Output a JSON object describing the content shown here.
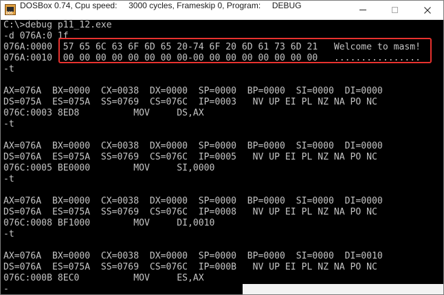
{
  "window": {
    "app_name": "DOSBox 0.74, Cpu speed:",
    "cpu_speed": "3000 cycles, Frameskip",
    "frameskip": "0, Program:",
    "program": "DEBUG",
    "icon": "dosbox-app-icon",
    "icon_text": "DOS BOX"
  },
  "controls": {
    "minimize": "minimize-icon",
    "maximize": "maximize-icon",
    "close": "close-icon"
  },
  "console": {
    "lines": [
      "C:\\>debug p11_12.exe",
      "-d 076A:0 1f",
      "076A:0000  57 65 6C 63 6F 6D 65 20-74 6F 20 6D 61 73 6D 21   Welcome to masm!",
      "076A:0010  00 00 00 00 00 00 00 00-00 00 00 00 00 00 00 00   ................",
      "-t",
      "",
      "AX=076A  BX=0000  CX=0038  DX=0000  SP=0000  BP=0000  SI=0000  DI=0000",
      "DS=075A  ES=075A  SS=0769  CS=076C  IP=0003   NV UP EI PL NZ NA PO NC",
      "076C:0003 8ED8          MOV     DS,AX",
      "-t",
      "",
      "AX=076A  BX=0000  CX=0038  DX=0000  SP=0000  BP=0000  SI=0000  DI=0000",
      "DS=076A  ES=075A  SS=0769  CS=076C  IP=0005   NV UP EI PL NZ NA PO NC",
      "076C:0005 BE0000        MOV     SI,0000",
      "-t",
      "",
      "AX=076A  BX=0000  CX=0038  DX=0000  SP=0000  BP=0000  SI=0000  DI=0000",
      "DS=076A  ES=075A  SS=0769  CS=076C  IP=0008   NV UP EI PL NZ NA PO NC",
      "076C:0008 BF1000        MOV     DI,0010",
      "-t",
      "",
      "AX=076A  BX=0000  CX=0038  DX=0000  SP=0000  BP=0000  SI=0000  DI=0010",
      "DS=076A  ES=075A  SS=0769  CS=076C  IP=000B   NV UP EI PL NZ NA PO NC",
      "076C:000B 8EC0          MOV     ES,AX",
      "-"
    ]
  },
  "colors": {
    "console_bg": "#000000",
    "console_text": "#c4c4c4",
    "highlight_border": "#e8322f",
    "titlebar_bg": "#ffffff"
  }
}
